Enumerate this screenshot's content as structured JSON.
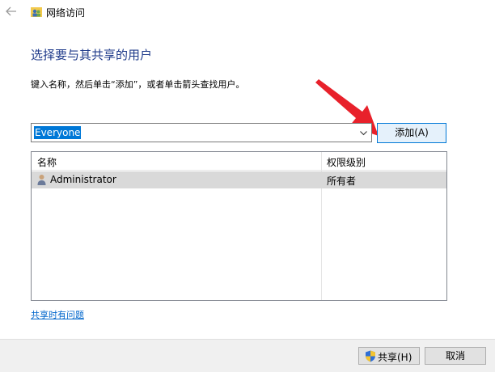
{
  "window": {
    "title": "网络访问",
    "icons": {
      "back": "back-arrow-icon",
      "app": "network-share-icon"
    }
  },
  "main": {
    "heading": "选择要与其共享的用户",
    "instruction": "键入名称，然后单击“添加”，或者单击箭头查找用户。"
  },
  "combo": {
    "value": "Everyone",
    "dropdown_icon": "chevron-down-icon"
  },
  "add_button": {
    "label": "添加(A)"
  },
  "annotation": {
    "arrow_color": "#e8212b"
  },
  "user_list": {
    "columns": [
      "名称",
      "权限级别"
    ],
    "rows": [
      {
        "name": "Administrator",
        "permission": "所有者",
        "icon": "user-icon"
      }
    ]
  },
  "help_link": {
    "label": "共享时有问题"
  },
  "footer": {
    "share_label": "共享(H)",
    "cancel_label": "取消",
    "share_icon": "shield-icon"
  },
  "colors": {
    "heading": "#1e3a8a",
    "selection": "#0078d7",
    "link": "#0066cc",
    "row_highlight": "#d9d9d9"
  }
}
